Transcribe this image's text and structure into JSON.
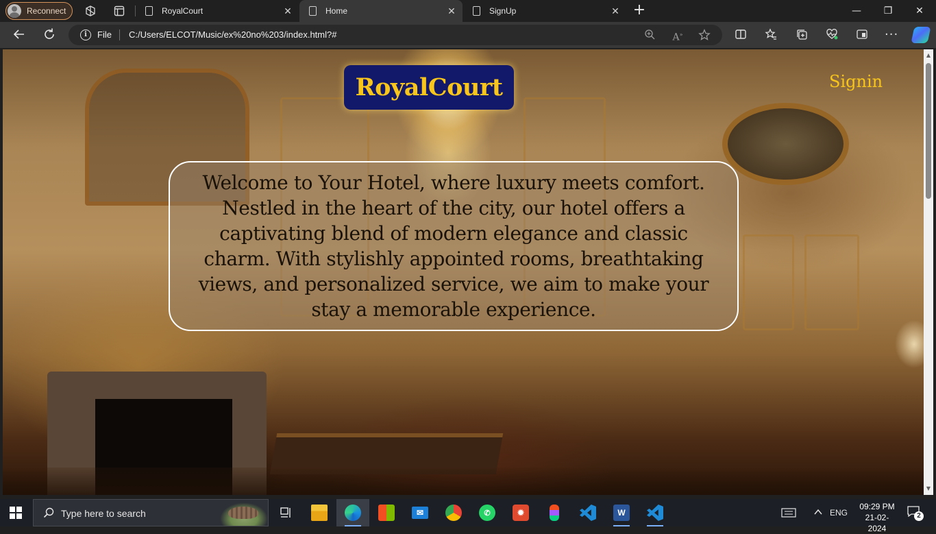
{
  "browser": {
    "profile_label": "Reconnect",
    "tabs": [
      {
        "title": "RoyalCourt",
        "active": false
      },
      {
        "title": "Home",
        "active": true
      },
      {
        "title": "SignUp",
        "active": false
      }
    ],
    "address": {
      "scheme_label": "File",
      "url": "C:/Users/ELCOT/Music/ex%20no%203/index.html?#"
    },
    "icons": [
      "workspaces-icon",
      "tab-actions-icon",
      "back-icon",
      "refresh-icon",
      "zoom-icon",
      "read-aloud-icon",
      "favorite-star-icon",
      "split-screen-icon",
      "favorites-icon",
      "collections-icon",
      "health-icon",
      "browser-essentials-icon",
      "more-icon",
      "copilot-icon"
    ]
  },
  "page": {
    "logo": "RoyalCourt",
    "signin_label": "Signin",
    "welcome_text": "Welcome to Your Hotel, where luxury meets comfort. Nestled in the heart of the city, our hotel offers a captivating blend of modern elegance and classic charm. With stylishly appointed rooms, breathtaking views, and personalized service, we aim to make your stay a memorable experience.",
    "colors": {
      "logo_background": "#12186a",
      "accent_gold": "#f7c51b"
    }
  },
  "taskbar": {
    "search_placeholder": "Type here to search",
    "apps": [
      "task-view-icon",
      "file-explorer-icon",
      "edge-icon",
      "store-icon",
      "mail-icon",
      "chrome-icon",
      "whatsapp-icon",
      "app-red-icon",
      "figma-icon",
      "vscode-icon",
      "word-icon",
      "vscode-icon"
    ],
    "tray": {
      "language": "ENG",
      "time": "09:29 PM",
      "date": "21-02-2024",
      "notification_count": "2"
    }
  }
}
